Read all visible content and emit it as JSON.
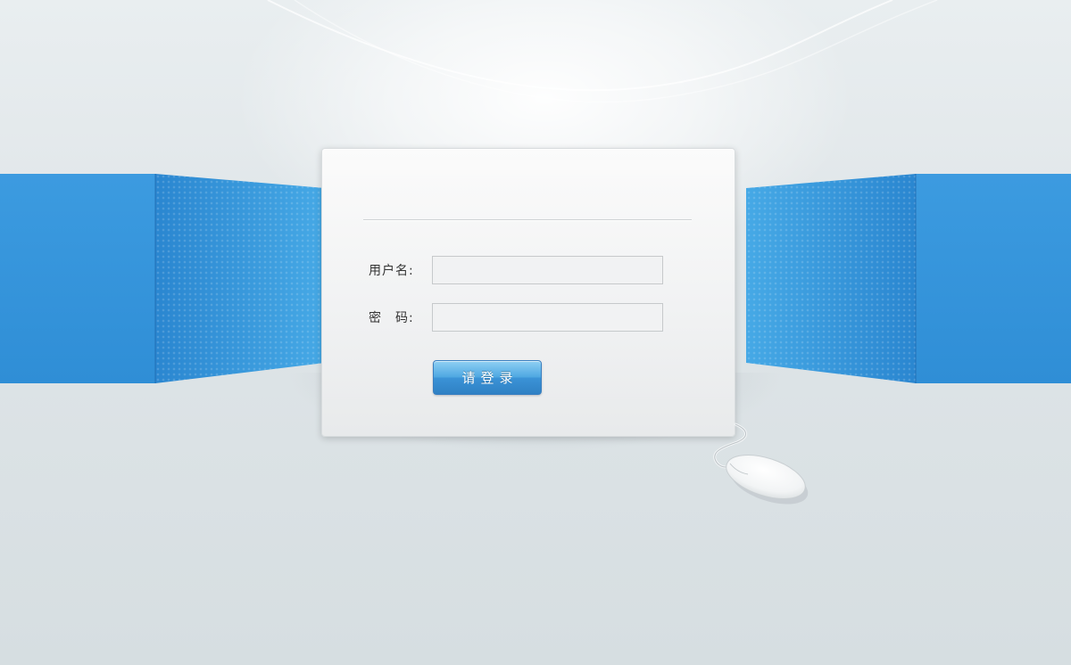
{
  "login_form": {
    "username_label": "用户名:",
    "username_value": "",
    "password_label": "密　码:",
    "password_value": "",
    "submit_label": "请登录"
  },
  "colors": {
    "wall_blue": "#3b96dc",
    "button_blue": "#4fa8e2",
    "background": "#dfe5e8"
  },
  "decorations": {
    "mouse_icon": "computer-mouse-icon"
  }
}
